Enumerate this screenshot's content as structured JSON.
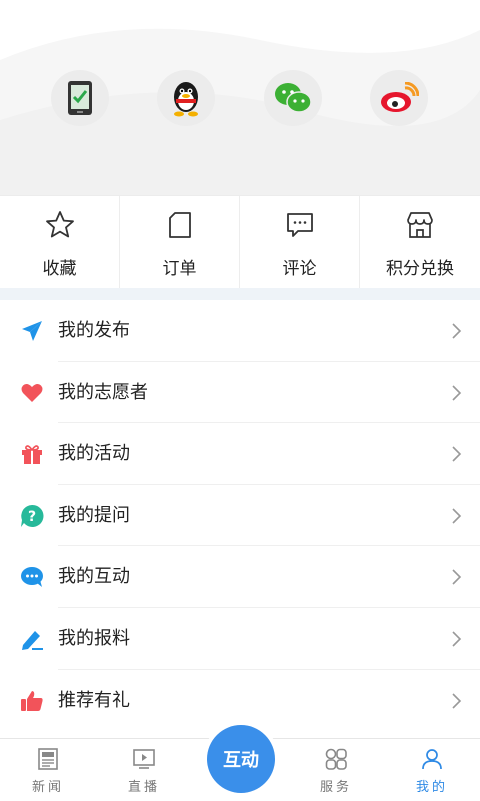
{
  "login": {
    "options": [
      {
        "name": "phone-login",
        "icon": "phone-icon"
      },
      {
        "name": "qq-login",
        "icon": "qq-icon"
      },
      {
        "name": "wechat-login",
        "icon": "wechat-icon"
      },
      {
        "name": "weibo-login",
        "icon": "weibo-icon"
      }
    ]
  },
  "quick": {
    "items": [
      {
        "label": "收藏",
        "icon": "star-icon"
      },
      {
        "label": "订单",
        "icon": "order-icon"
      },
      {
        "label": "评论",
        "icon": "comment-icon"
      },
      {
        "label": "积分兑换",
        "icon": "store-icon"
      }
    ]
  },
  "menu": {
    "items": [
      {
        "label": "我的发布",
        "icon": "send-icon",
        "color": "#1f93e8"
      },
      {
        "label": "我的志愿者",
        "icon": "heart-icon",
        "color": "#f2535a"
      },
      {
        "label": "我的活动",
        "icon": "gift-icon",
        "color": "#f2535a"
      },
      {
        "label": "我的提问",
        "icon": "question-icon",
        "color": "#27b99a"
      },
      {
        "label": "我的互动",
        "icon": "chat-icon",
        "color": "#1f93e8"
      },
      {
        "label": "我的报料",
        "icon": "pen-icon",
        "color": "#1f93e8"
      },
      {
        "label": "推荐有礼",
        "icon": "thumbs-up-icon",
        "color": "#f2535a"
      }
    ]
  },
  "nav": {
    "items": [
      {
        "label": "新闻",
        "icon": "news-icon"
      },
      {
        "label": "直播",
        "icon": "live-icon"
      },
      {
        "label": "服务",
        "icon": "service-icon"
      },
      {
        "label": "我的",
        "icon": "user-icon"
      }
    ],
    "center_label": "互动",
    "accent": "#2f8ae5"
  }
}
